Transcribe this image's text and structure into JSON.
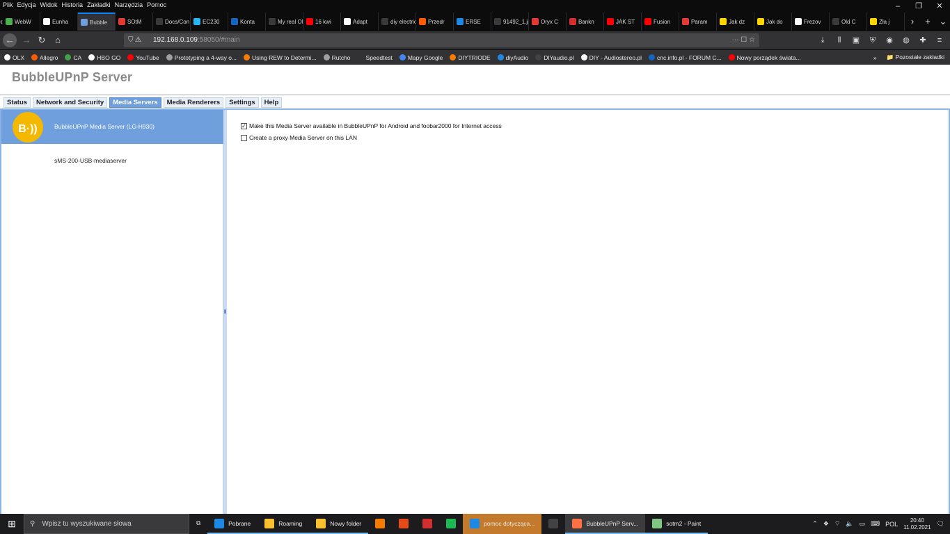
{
  "browser": {
    "menu": [
      "Plik",
      "Edycja",
      "Widok",
      "Historia",
      "Zakładki",
      "Narzędzia",
      "Pomoc"
    ],
    "window_controls": [
      "–",
      "❐",
      "✕"
    ],
    "tabs": [
      {
        "label": "WebW",
        "color": "#4caf50"
      },
      {
        "label": "Eunha",
        "color": "#ffffff"
      },
      {
        "label": "Bubble",
        "color": "#6f9fdd",
        "active": true
      },
      {
        "label": "SOtM",
        "color": "#e53935"
      },
      {
        "label": "Docs/Con",
        "color": "#3a3a3c"
      },
      {
        "label": "EC230",
        "color": "#29b6f6"
      },
      {
        "label": "Konta",
        "color": "#1565c0"
      },
      {
        "label": "My real OI",
        "color": "#3a3a3c"
      },
      {
        "label": "16 kwi",
        "color": "#ff0000"
      },
      {
        "label": "Adapt",
        "color": "#ffffff"
      },
      {
        "label": "diy electric",
        "color": "#3a3a3c"
      },
      {
        "label": "Przedr",
        "color": "#ff5a00"
      },
      {
        "label": "ERSE",
        "color": "#1e88e5"
      },
      {
        "label": "91492_1.jp",
        "color": "#3a3a3c"
      },
      {
        "label": "Oryx C",
        "color": "#e53935"
      },
      {
        "label": "Bankn",
        "color": "#d32f2f"
      },
      {
        "label": "JAK ST",
        "color": "#ff0000"
      },
      {
        "label": "Fusion",
        "color": "#ff0000"
      },
      {
        "label": "Param",
        "color": "#e53935"
      },
      {
        "label": "Jak dz",
        "color": "#ffd600"
      },
      {
        "label": "Jak do",
        "color": "#ffd600"
      },
      {
        "label": "Frezov",
        "color": "#ffffff"
      },
      {
        "label": "Old C",
        "color": "#3a3a3c"
      },
      {
        "label": "Zła j",
        "color": "#ffd600"
      }
    ],
    "url_host": "192.168.0.109",
    "url_rest": ":58050/#main",
    "bookmarks": [
      {
        "label": "OLX",
        "color": "#ffffff"
      },
      {
        "label": "Allegro",
        "color": "#ff5a00"
      },
      {
        "label": "CA",
        "color": "#43a047"
      },
      {
        "label": "HBO GO",
        "color": "#ffffff"
      },
      {
        "label": "YouTube",
        "color": "#ff0000"
      },
      {
        "label": "Prototyping a 4-way o...",
        "color": "#9e9e9e"
      },
      {
        "label": "Using REW to Determi...",
        "color": "#f57c00"
      },
      {
        "label": "Rutcho",
        "color": "#9e9e9e"
      },
      {
        "label": "Speedtest",
        "color": "#323234"
      },
      {
        "label": "Mapy Google",
        "color": "#4285f4"
      },
      {
        "label": "DIYTRIODE",
        "color": "#f57c00"
      },
      {
        "label": "diyAudio",
        "color": "#1e88e5"
      },
      {
        "label": "DIYaudio.pl",
        "color": "#424242"
      },
      {
        "label": "DIY - Audiostereo.pl",
        "color": "#ffffff"
      },
      {
        "label": "cnc.info.pl - FORUM C...",
        "color": "#1565c0"
      },
      {
        "label": "Nowy porządek świata...",
        "color": "#ff0000"
      }
    ],
    "other_bookmarks": "Pozostałe zakładki"
  },
  "app": {
    "title": "BubbleUPnP  Server",
    "tabs": [
      {
        "label": "Status"
      },
      {
        "label": "Network and Security"
      },
      {
        "label": "Media Servers",
        "active": true
      },
      {
        "label": "Media Renderers"
      },
      {
        "label": "Settings"
      },
      {
        "label": "Help"
      }
    ],
    "servers": [
      {
        "name": "BubbleUPnP Media Server (LG-H930)",
        "selected": true,
        "logo_text": "B·))"
      },
      {
        "name": "sMS-200-USB-mediaserver",
        "selected": false
      }
    ],
    "options": [
      {
        "label": "Make this Media Server available in BubbleUPnP for Android and foobar2000 for Internet access",
        "checked": true
      },
      {
        "label": "Create a proxy Media Server on this LAN",
        "checked": false
      }
    ]
  },
  "taskbar": {
    "search_placeholder": "Wpisz tu wyszukiwane słowa",
    "items": [
      {
        "label": "Pobrane",
        "color": "#1e88e5",
        "state": "run"
      },
      {
        "label": "Roaming",
        "color": "#fbc02d",
        "state": "run"
      },
      {
        "label": "Nowy folder",
        "color": "#fbc02d",
        "state": "run"
      },
      {
        "label": "",
        "color": "#f57c00",
        "state": ""
      },
      {
        "label": "",
        "color": "#e64a19",
        "state": ""
      },
      {
        "label": "",
        "color": "#d32f2f",
        "state": ""
      },
      {
        "label": "",
        "color": "#1db954",
        "state": ""
      },
      {
        "label": "pomoc dotycząca...",
        "color": "#1e88e5",
        "state": "hl"
      },
      {
        "label": "",
        "color": "#424242",
        "state": ""
      },
      {
        "label": "BubbleUPnP Serv...",
        "color": "#ff7043",
        "state": "act"
      },
      {
        "label": "sotm2 - Paint",
        "color": "#81c784",
        "state": "run"
      }
    ],
    "language": "POL",
    "time": "20:40",
    "date": "11.02.2021"
  }
}
